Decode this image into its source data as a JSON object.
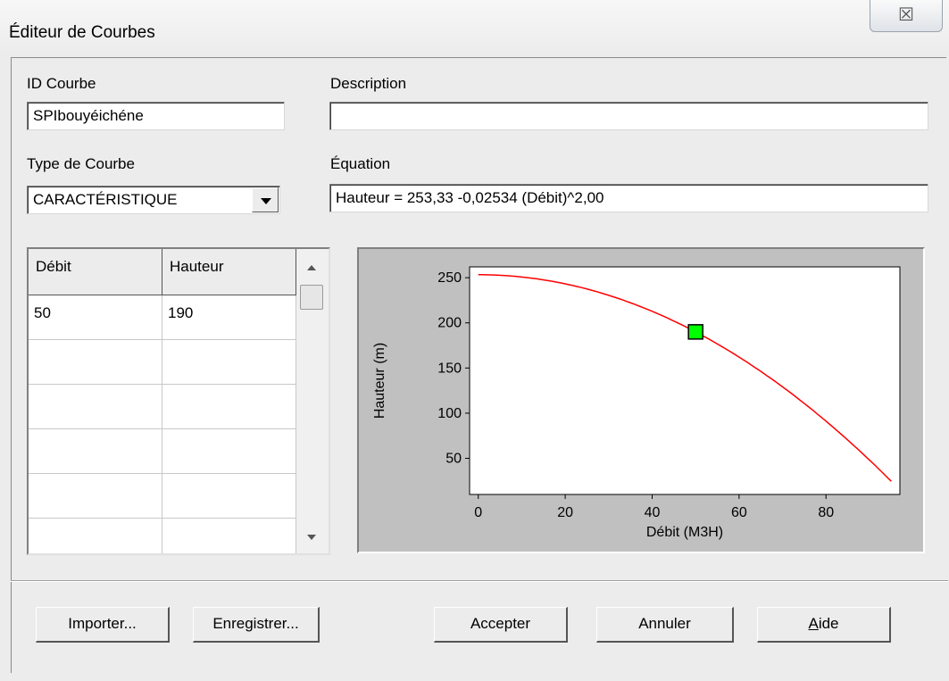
{
  "window": {
    "title": "Éditeur de Courbes",
    "close_glyph": "☒"
  },
  "fields": {
    "id_label": "ID Courbe",
    "id_value": "SPIbouyéichéne",
    "description_label": "Description",
    "description_value": "",
    "type_label": "Type de Courbe",
    "type_value": "CARACTÉRISTIQUE",
    "equation_label": "Équation",
    "equation_value": "Hauteur = 253,33 -0,02534 (Débit)^2,00"
  },
  "table": {
    "columns": [
      "Débit",
      "Hauteur"
    ],
    "rows": [
      [
        "50",
        "190"
      ],
      [
        "",
        ""
      ],
      [
        "",
        ""
      ],
      [
        "",
        ""
      ],
      [
        "",
        ""
      ],
      [
        "",
        ""
      ]
    ]
  },
  "buttons": {
    "import": "Importer...",
    "save": "Enregistrer...",
    "accept": "Accepter",
    "cancel": "Annuler",
    "help_first": "A",
    "help_rest": "ide"
  },
  "chart_data": {
    "type": "line",
    "xlabel": "Débit (M3H)",
    "ylabel": "Hauteur (m)",
    "xlim": [
      -2,
      97
    ],
    "ylim": [
      10,
      262
    ],
    "xticks": [
      0,
      20,
      40,
      60,
      80
    ],
    "yticks": [
      50,
      100,
      150,
      200,
      250
    ],
    "grid": false,
    "series": [
      {
        "equation": "Hauteur = 253,33 -0,02534 (Débit)^2,00",
        "coefficients": {
          "a": 253.33,
          "b": 0.02534,
          "c": 2.0
        },
        "x_range": [
          0,
          95
        ],
        "color": "#ff0000"
      }
    ],
    "points": [
      {
        "x": 50,
        "y": 190,
        "color": "#00ff00"
      }
    ]
  },
  "colors": {
    "window_bg": "#ececec",
    "curve": "#ff0000",
    "point": "#00ff00"
  }
}
